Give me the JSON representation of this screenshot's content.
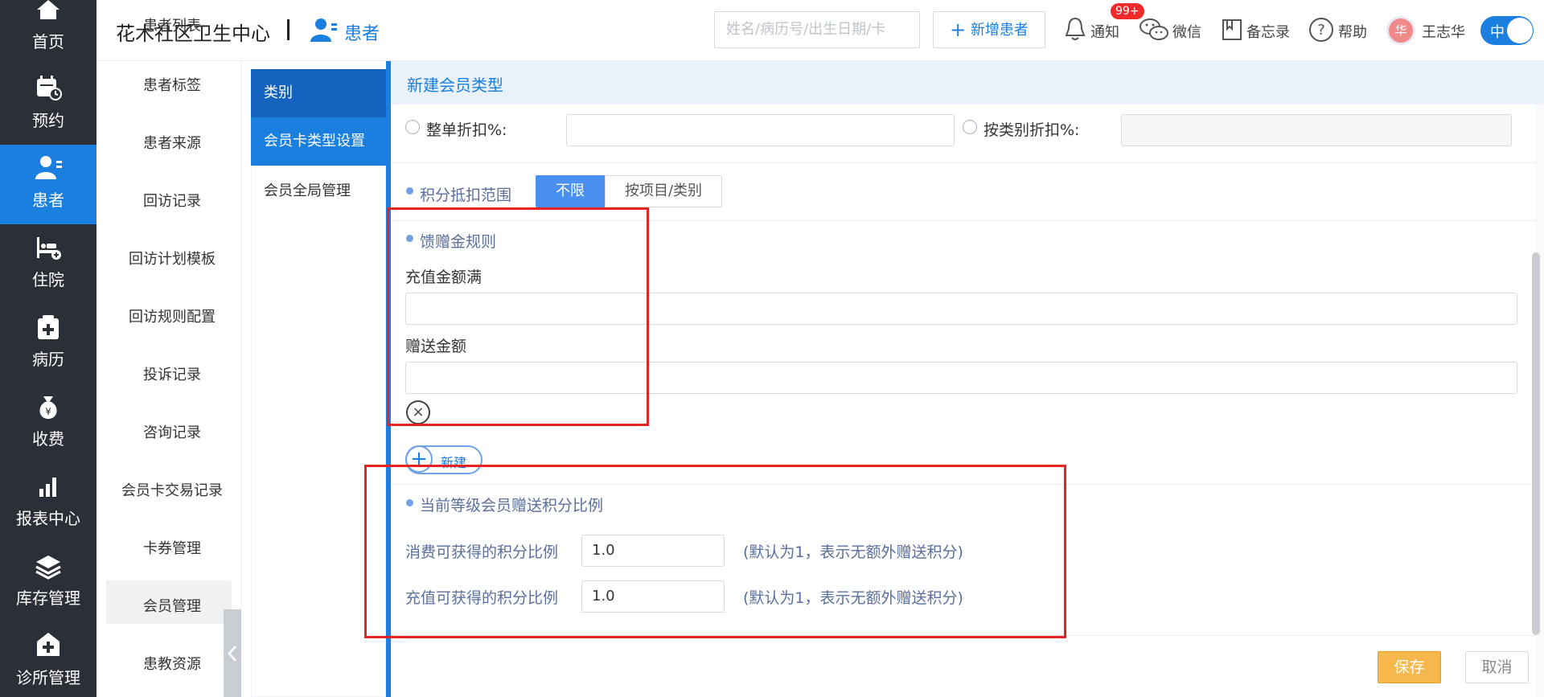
{
  "nav": {
    "items": [
      {
        "label": "首页",
        "icon": "home-icon"
      },
      {
        "label": "预约",
        "icon": "calendar-icon"
      },
      {
        "label": "患者",
        "icon": "patient-icon",
        "active": true
      },
      {
        "label": "住院",
        "icon": "bed-icon"
      },
      {
        "label": "病历",
        "icon": "medical-record-icon"
      },
      {
        "label": "收费",
        "icon": "money-bag-icon"
      },
      {
        "label": "报表中心",
        "icon": "bar-chart-icon"
      },
      {
        "label": "库存管理",
        "icon": "stack-icon"
      },
      {
        "label": "诊所管理",
        "icon": "clinic-icon"
      }
    ]
  },
  "header": {
    "clinic_name": "花木社区卫生中心",
    "module_label": "患者",
    "search_placeholder": "姓名/病历号/出生日期/卡",
    "add_patient_label": "新增患者",
    "notify_label": "通知",
    "notify_badge": "99+",
    "wechat_label": "微信",
    "memo_label": "备忘录",
    "help_label": "帮助",
    "user_avatar_char": "华",
    "user_name": "王志华",
    "toggle_label": "中"
  },
  "submenu": {
    "items": [
      "患者列表",
      "患者标签",
      "患者来源",
      "回访记录",
      "回访计划模板",
      "回访规则配置",
      "投诉记录",
      "咨询记录",
      "会员卡交易记录",
      "卡券管理",
      "会员管理",
      "患教资源"
    ],
    "active": "会员管理"
  },
  "category": {
    "header": "类别",
    "items": [
      "会员卡类型设置",
      "会员全局管理"
    ]
  },
  "form": {
    "title": "新建会员类型",
    "whole_discount_label": "整单折扣%:",
    "category_discount_label": "按类别折扣%:",
    "points_scope_label": "积分抵扣范围",
    "scope_options": [
      "不限",
      "按项目/类别"
    ],
    "gift_rule_label": "馈赠金规则",
    "recharge_min_label": "充值金额满",
    "gift_amount_label": "赠送金额",
    "new_rule_label": "新建",
    "points_ratio_section": "当前等级会员赠送积分比例",
    "consume_ratio_label": "消费可获得的积分比例",
    "consume_ratio_value": "1.0",
    "consume_ratio_hint": "(默认为1，表示无额外赠送积分)",
    "recharge_ratio_label": "充值可获得的积分比例",
    "recharge_ratio_value": "1.0",
    "recharge_ratio_hint": "(默认为1，表示无额外赠送积分)"
  },
  "actions": {
    "save_label": "保存",
    "cancel_label": "取消"
  },
  "colors": {
    "primary": "#1b7fe0",
    "nav_bg": "#2b2f38",
    "save_bg": "#f6b84c",
    "highlight_red": "#e62222"
  }
}
